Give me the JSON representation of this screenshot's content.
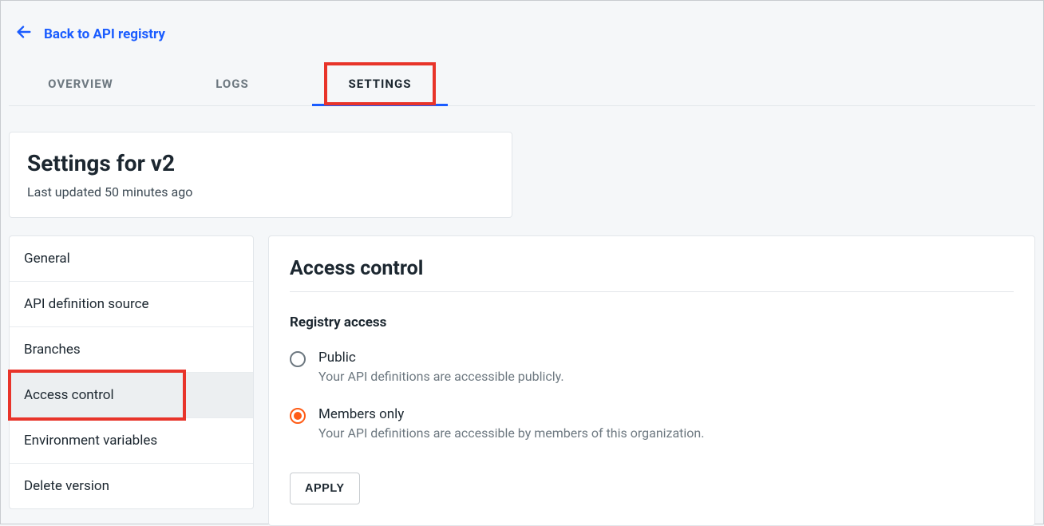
{
  "back_link": {
    "label": "Back to API registry"
  },
  "tabs": {
    "overview": "OVERVIEW",
    "logs": "LOGS",
    "settings": "SETTINGS"
  },
  "header": {
    "title": "Settings for v2",
    "subtitle": "Last updated 50 minutes ago"
  },
  "sidebar": {
    "items": [
      {
        "label": "General"
      },
      {
        "label": "API definition source"
      },
      {
        "label": "Branches"
      },
      {
        "label": "Access control"
      },
      {
        "label": "Environment variables"
      },
      {
        "label": "Delete version"
      }
    ]
  },
  "panel": {
    "title": "Access control",
    "group_label": "Registry access",
    "options": [
      {
        "title": "Public",
        "desc": "Your API definitions are accessible publicly.",
        "checked": false
      },
      {
        "title": "Members only",
        "desc": "Your API definitions are accessible by members of this organization.",
        "checked": true
      }
    ],
    "apply_label": "APPLY"
  }
}
